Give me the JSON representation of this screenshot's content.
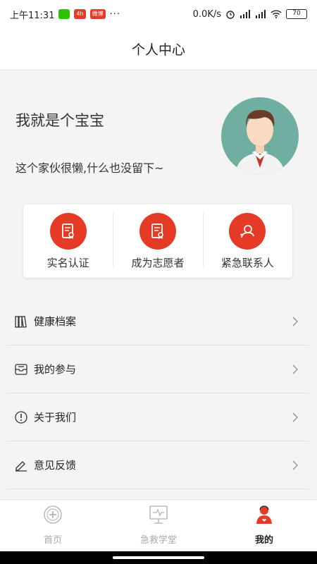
{
  "status_bar": {
    "time": "上午11:31",
    "network_speed": "0.0K/s",
    "battery": "70",
    "dots": "···",
    "badges": [
      "4h",
      "微博"
    ]
  },
  "header": {
    "title": "个人中心"
  },
  "profile": {
    "nickname": "我就是个宝宝",
    "signature": "这个家伙很懒,什么也没留下~"
  },
  "quick_actions": [
    {
      "label": "实名认证",
      "icon": "certificate-icon"
    },
    {
      "label": "成为志愿者",
      "icon": "volunteer-document-icon"
    },
    {
      "label": "紧急联系人",
      "icon": "contact-icon"
    }
  ],
  "menu": [
    {
      "label": "健康档案",
      "icon": "archive-icon"
    },
    {
      "label": "我的参与",
      "icon": "inbox-icon"
    },
    {
      "label": "关于我们",
      "icon": "info-icon"
    },
    {
      "label": "意见反馈",
      "icon": "edit-icon"
    }
  ],
  "tabs": [
    {
      "label": "首页",
      "icon": "home-cross-icon",
      "active": false
    },
    {
      "label": "急救学堂",
      "icon": "classroom-monitor-icon",
      "active": false
    },
    {
      "label": "我的",
      "icon": "user-profile-icon",
      "active": true
    }
  ],
  "colors": {
    "accent": "#e53a25",
    "avatar_bg": "#6faea0"
  }
}
